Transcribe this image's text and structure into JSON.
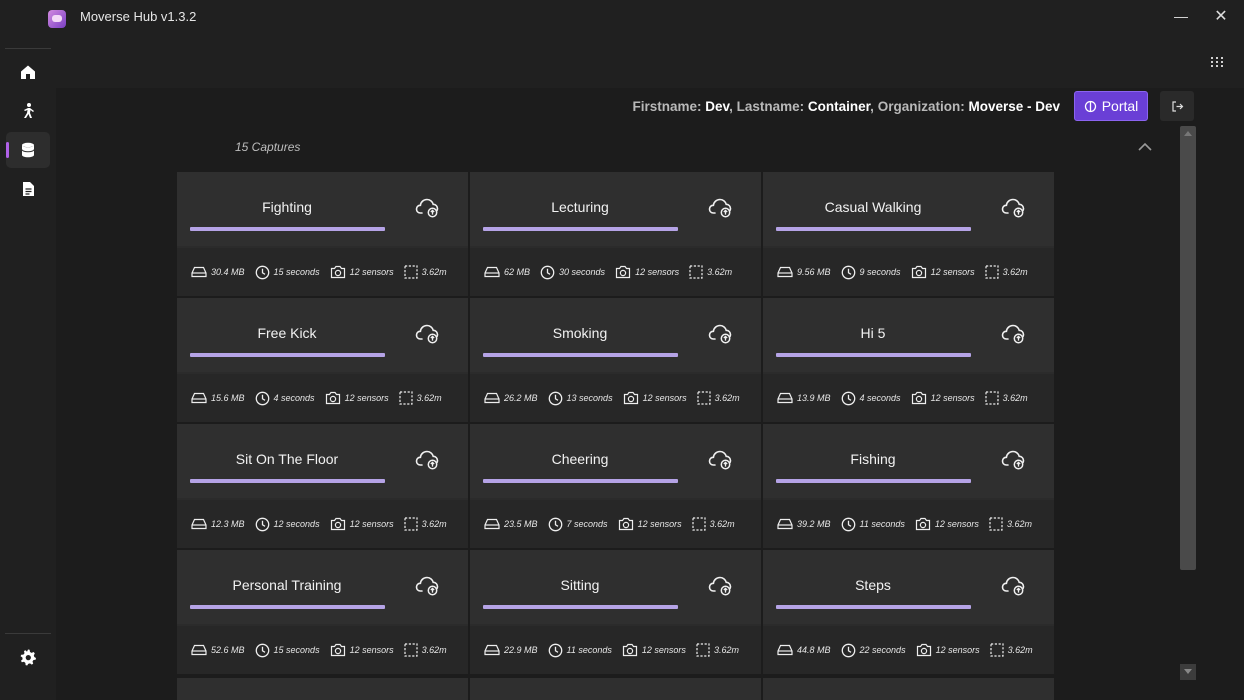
{
  "window": {
    "title": "Moverse Hub v1.3.2",
    "minimize_glyph": "—",
    "close_glyph": "✕"
  },
  "sidebar": {
    "items": [
      {
        "name": "home-icon",
        "active": false
      },
      {
        "name": "person-icon",
        "active": false
      },
      {
        "name": "database-icon",
        "active": true
      },
      {
        "name": "document-icon",
        "active": false
      }
    ],
    "bottom": {
      "name": "gear-icon"
    }
  },
  "user": {
    "firstname_label": "Firstname:",
    "firstname": "Dev",
    "lastname_label": "Lastname:",
    "lastname": "Container",
    "organization_label": "Organization:",
    "organization": "Moverse - Dev"
  },
  "header": {
    "portal_label": "Portal"
  },
  "captures": {
    "count_label": "15 Captures",
    "items": [
      {
        "name": "Fighting",
        "size": "30.4 MB",
        "duration": "15 seconds",
        "sensors": "12 sensors",
        "area": "3.62m"
      },
      {
        "name": "Lecturing",
        "size": "62 MB",
        "duration": "30 seconds",
        "sensors": "12 sensors",
        "area": "3.62m"
      },
      {
        "name": "Casual Walking",
        "size": "9.56 MB",
        "duration": "9 seconds",
        "sensors": "12 sensors",
        "area": "3.62m"
      },
      {
        "name": "Free Kick",
        "size": "15.6 MB",
        "duration": "4 seconds",
        "sensors": "12 sensors",
        "area": "3.62m"
      },
      {
        "name": "Smoking",
        "size": "26.2 MB",
        "duration": "13 seconds",
        "sensors": "12 sensors",
        "area": "3.62m"
      },
      {
        "name": "Hi 5",
        "size": "13.9 MB",
        "duration": "4 seconds",
        "sensors": "12 sensors",
        "area": "3.62m"
      },
      {
        "name": "Sit On The Floor",
        "size": "12.3 MB",
        "duration": "12 seconds",
        "sensors": "12 sensors",
        "area": "3.62m"
      },
      {
        "name": "Cheering",
        "size": "23.5 MB",
        "duration": "7 seconds",
        "sensors": "12 sensors",
        "area": "3.62m"
      },
      {
        "name": "Fishing",
        "size": "39.2 MB",
        "duration": "11 seconds",
        "sensors": "12 sensors",
        "area": "3.62m"
      },
      {
        "name": "Personal Training",
        "size": "52.6 MB",
        "duration": "15 seconds",
        "sensors": "12 sensors",
        "area": "3.62m"
      },
      {
        "name": "Sitting",
        "size": "22.9 MB",
        "duration": "11 seconds",
        "sensors": "12 sensors",
        "area": "3.62m"
      },
      {
        "name": "Steps",
        "size": "44.8 MB",
        "duration": "22 seconds",
        "sensors": "12 sensors",
        "area": "3.62m"
      }
    ]
  },
  "colors": {
    "accent": "#6a3fd6",
    "progress": "#b5a3e6",
    "active_indicator": "#b061e8"
  }
}
